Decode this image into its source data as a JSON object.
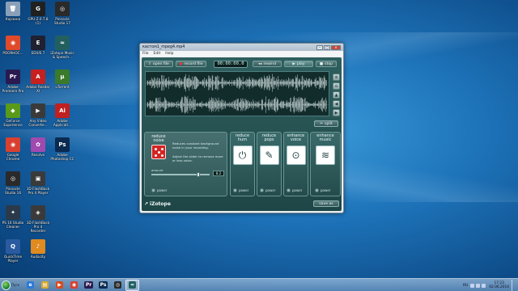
{
  "desktop": {
    "icons": [
      {
        "label": "Корзина",
        "color": "#8aa0b8",
        "glyph": "🗑"
      },
      {
        "label": "GPU-Z.0.7.8 (1)",
        "color": "#202020",
        "glyph": "G"
      },
      {
        "label": "Pinnacle Studio 17",
        "color": "#2a2a2a",
        "glyph": "◎"
      },
      {
        "label": "РОО9НОС...",
        "color": "#e04a2a",
        "glyph": "◉"
      },
      {
        "label": "EDIUS 7",
        "color": "#202030",
        "glyph": "E"
      },
      {
        "label": "iZotope Music & Speech...",
        "color": "#226060",
        "glyph": "≈"
      },
      {
        "label": "Adobe Premiere Pro",
        "color": "#2a1a50",
        "glyph": "Pr"
      },
      {
        "label": "Adobe Reader XI",
        "color": "#c62020",
        "glyph": "A"
      },
      {
        "label": "uTorrent",
        "color": "#3a7a2a",
        "glyph": "µ"
      },
      {
        "label": "GeForce Experience",
        "color": "#5a9a1a",
        "glyph": "◆"
      },
      {
        "label": "Any Video Converte...",
        "color": "#3a3a3a",
        "glyph": "▶"
      },
      {
        "label": "Adobe Applicati...",
        "color": "#c02020",
        "glyph": "Ai"
      },
      {
        "label": "Google Chrome",
        "color": "#d94030",
        "glyph": "◉"
      },
      {
        "label": "Resolve",
        "color": "#a04ab0",
        "glyph": "✿"
      },
      {
        "label": "Adobe Photoshop CC",
        "color": "#0a2a50",
        "glyph": "Ps"
      },
      {
        "label": "Pinnacle Studio 16",
        "color": "#2a2a2a",
        "glyph": "◎"
      },
      {
        "label": "3D FlashBack Pro 4 Player",
        "color": "#3a3a3a",
        "glyph": "▣"
      },
      {
        "label": "",
        "color": "transparent",
        "glyph": ""
      },
      {
        "label": "PS 16 Studio Cleaner",
        "color": "#2a3a4a",
        "glyph": "✦"
      },
      {
        "label": "3D FlashBack Pro 4 Recorder",
        "color": "#3a3a3a",
        "glyph": "◈"
      },
      {
        "label": "",
        "color": "transparent",
        "glyph": ""
      },
      {
        "label": "QuickTime Player",
        "color": "#2a5aa0",
        "glyph": "Q"
      },
      {
        "label": "Audacity",
        "color": "#e08a20",
        "glyph": "♪"
      }
    ]
  },
  "window": {
    "title": "кастом1_mpeg4.mp4",
    "minimize": "–",
    "maximize": "□",
    "close": "✕",
    "menu": [
      "File",
      "Edit",
      "Help"
    ]
  },
  "toolbar": {
    "open_file": "open file",
    "record_file": "record file",
    "time": "00:00:00.0",
    "rewind": "rewind",
    "play": "play",
    "stop": "stop",
    "open_glyph": "⇪",
    "record_glyph": "●",
    "rewind_glyph": "◂◂",
    "play_glyph": "▶",
    "stop_glyph": "■"
  },
  "side_tools": {
    "zoom_in": "⊕",
    "zoom_out": "⊖",
    "up": "▲",
    "left": "◀",
    "right": "▶"
  },
  "split": "split",
  "split_glyph": "✂",
  "effects": {
    "reduce_noise": {
      "title": "reduce noise",
      "desc1": "Reduces constant background noise in your recording.",
      "desc2": "Adjust the slider to remove more or less noise.",
      "amount_label": "amount",
      "amount_value": "8.2",
      "amount_max": 10,
      "power": "power"
    },
    "reduce_hum": {
      "title": "reduce hum",
      "power": "power",
      "glyph": "⏻"
    },
    "reduce_pops": {
      "title": "reduce pops",
      "power": "power",
      "glyph": "✎"
    },
    "enhance_voice": {
      "title": "enhance voice",
      "power": "power",
      "glyph": "⊙"
    },
    "enhance_music": {
      "title": "enhance music",
      "power": "power",
      "glyph": "≋"
    }
  },
  "footer": {
    "logo": "iZotope",
    "logo_glyph": "↗",
    "save_as": "save as"
  },
  "taskbar": {
    "start": "Пуск",
    "items": [
      {
        "glyph": "e",
        "color": "#2a7ad8"
      },
      {
        "glyph": "▤",
        "color": "#d8a830"
      },
      {
        "glyph": "▶",
        "color": "#d84a20"
      },
      {
        "glyph": "◉",
        "color": "#d94030"
      },
      {
        "glyph": "Pr",
        "color": "#2a1a50"
      },
      {
        "glyph": "Ps",
        "color": "#0a2a50"
      },
      {
        "glyph": "◎",
        "color": "#2a2a2a"
      },
      {
        "glyph": "≈",
        "color": "#226060",
        "active": true
      }
    ],
    "lang": "RU",
    "time": "17:23",
    "date": "02.06.2014"
  }
}
